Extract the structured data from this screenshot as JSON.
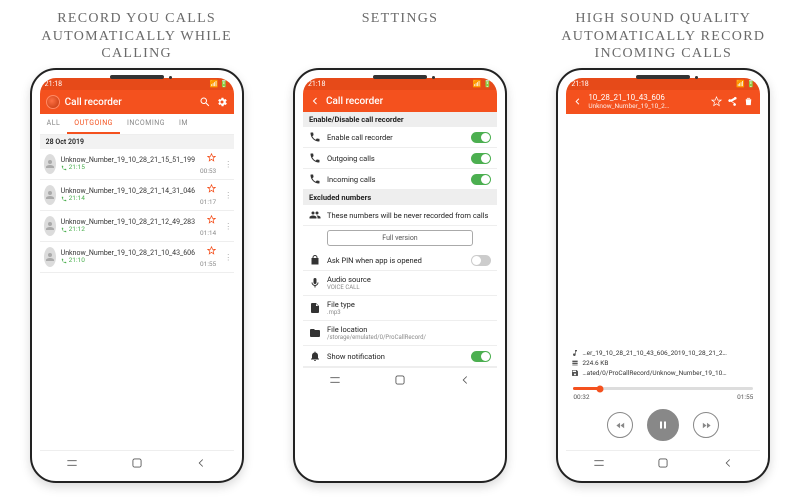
{
  "captions": {
    "c1": "RECORD YOU CALLS AUTOMATICALLY WHILE CALLING",
    "c2": "SETTINGS",
    "c3": "HIGH SOUND QUALITY AUTOMATICALLY RECORD INCOMING CALLS"
  },
  "status_time": "21:18",
  "app_title": "Call recorder",
  "tabs": {
    "all": "ALL",
    "out": "OUTGOING",
    "in": "INCOMING",
    "imp": "IM"
  },
  "list": {
    "date_header": "28 Oct 2019",
    "rows": [
      {
        "name": "Unknow_Number_19_10_28_21_15_51_199",
        "time": "21:15",
        "dur": "00:53"
      },
      {
        "name": "Unknow_Number_19_10_28_21_14_31_046",
        "time": "21:14",
        "dur": "01:17"
      },
      {
        "name": "Unknow_Number_19_10_28_21_12_49_283",
        "time": "21:12",
        "dur": "01:14"
      },
      {
        "name": "Unknow_Number_19_10_28_21_10_43_606",
        "time": "21:10",
        "dur": "01:55"
      }
    ]
  },
  "settings": {
    "sec1": "Enable/Disable call recorder",
    "enable": "Enable call recorder",
    "out": "Outgoing calls",
    "in": "Incoming calls",
    "sec2": "Excluded numbers",
    "excl_desc": "These numbers will be never recorded from calls",
    "full": "Full version",
    "pin": "Ask PIN when app is opened",
    "audio": "Audio source",
    "audio_sub": "VOICE CALL",
    "ftype": "File type",
    "ftype_sub": ".mp3",
    "floc": "File location",
    "floc_sub": "/storage/emulated/0/ProCallRecord/",
    "notif": "Show notification"
  },
  "player": {
    "t1": "10_28_21_10_43_606",
    "t2": "Unknow_Number_19_10_2…",
    "meta_name": "…er_19_10_28_21_10_43_606_2019_10_28_21_2…",
    "meta_size": "224.6 KB",
    "meta_path": "…ated/0/ProCallRecord/Unknow_Number_19_10…",
    "pos": "00:32",
    "dur": "01:55"
  }
}
